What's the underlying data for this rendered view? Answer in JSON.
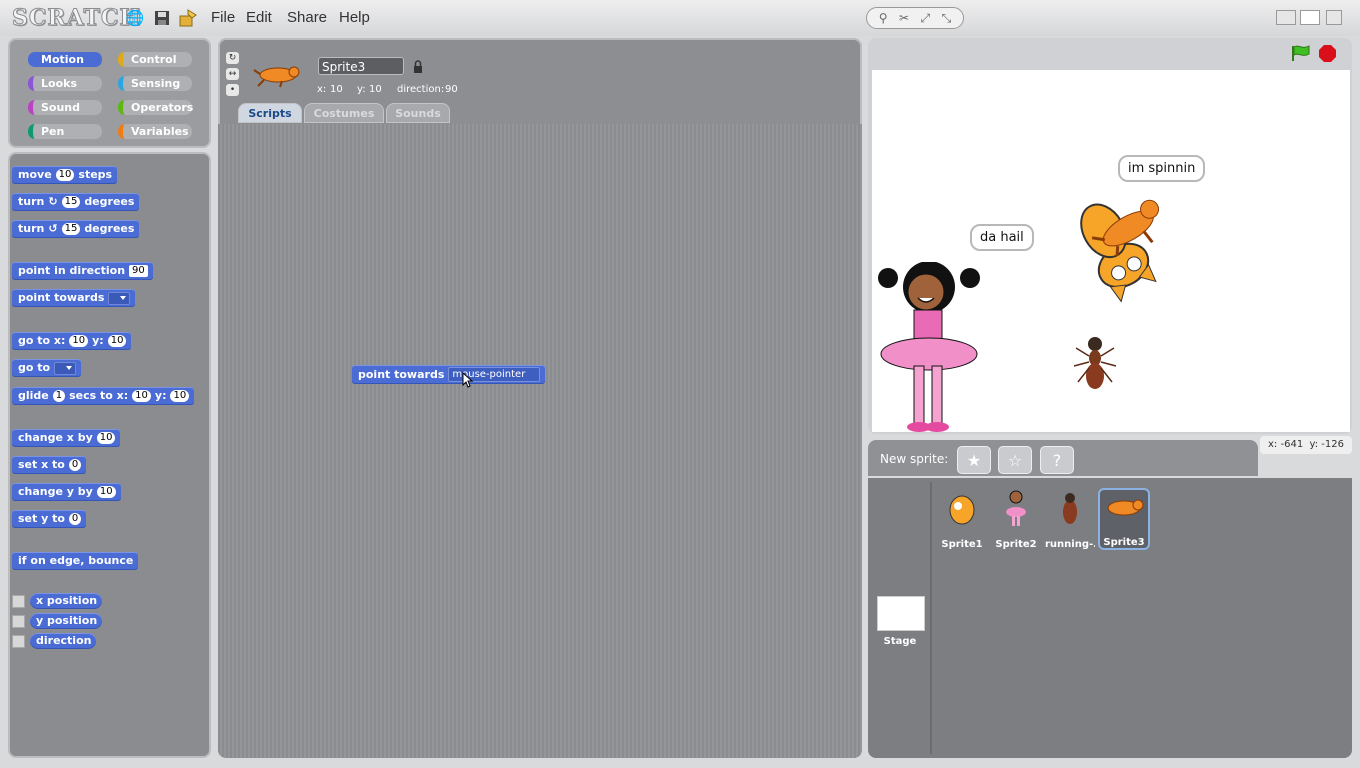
{
  "app": {
    "logo": "SCRATCH"
  },
  "menu": [
    "File",
    "Edit",
    "Share",
    "Help"
  ],
  "categories": [
    {
      "label": "Motion",
      "color": "#4a6cd4"
    },
    {
      "label": "Control",
      "color": "#e1a91a"
    },
    {
      "label": "Looks",
      "color": "#8a55d7"
    },
    {
      "label": "Sensing",
      "color": "#2ca5e2"
    },
    {
      "label": "Sound",
      "color": "#bb42c3"
    },
    {
      "label": "Operators",
      "color": "#5cb712"
    },
    {
      "label": "Pen",
      "color": "#0e9a6c"
    },
    {
      "label": "Variables",
      "color": "#ee7d16"
    }
  ],
  "blocks": {
    "move": {
      "pre": "move",
      "val": "10",
      "post": "steps"
    },
    "turn_cw": {
      "pre": "turn",
      "icon": "↻",
      "val": "15",
      "post": "degrees"
    },
    "turn_ccw": {
      "pre": "turn",
      "icon": "↺",
      "val": "15",
      "post": "degrees"
    },
    "point_dir": {
      "pre": "point in direction",
      "val": "90"
    },
    "point_towards": {
      "pre": "point towards"
    },
    "goto_xy": {
      "pre": "go to x:",
      "x": "10",
      "mid": "y:",
      "y": "10"
    },
    "goto": {
      "pre": "go to"
    },
    "glide": {
      "pre": "glide",
      "secs": "1",
      "mid1": "secs to x:",
      "x": "10",
      "mid2": "y:",
      "y": "10"
    },
    "change_x": {
      "pre": "change x by",
      "val": "10"
    },
    "set_x": {
      "pre": "set x to",
      "val": "0"
    },
    "change_y": {
      "pre": "change y by",
      "val": "10"
    },
    "set_y": {
      "pre": "set y to",
      "val": "0"
    },
    "bounce": {
      "pre": "if on edge, bounce"
    },
    "reporters": [
      "x position",
      "y position",
      "direction"
    ]
  },
  "sprite_info": {
    "name": "Sprite3",
    "x_label": "x:",
    "x": "10",
    "y_label": "y:",
    "y": "10",
    "dir_label": "direction:",
    "direction": "90"
  },
  "tabs": [
    "Scripts",
    "Costumes",
    "Sounds"
  ],
  "script_block": {
    "pre": "point towards",
    "value": "mouse-pointer"
  },
  "stage": {
    "bubble1": "da hail",
    "bubble2": "im spinnin",
    "coords": {
      "x_label": "x:",
      "x": "-641",
      "y_label": "y:",
      "y": "-126"
    }
  },
  "new_sprite_label": "New sprite:",
  "sprites": [
    "Sprite1",
    "Sprite2",
    "running-...",
    "Sprite3"
  ],
  "stage_thumb_label": "Stage"
}
